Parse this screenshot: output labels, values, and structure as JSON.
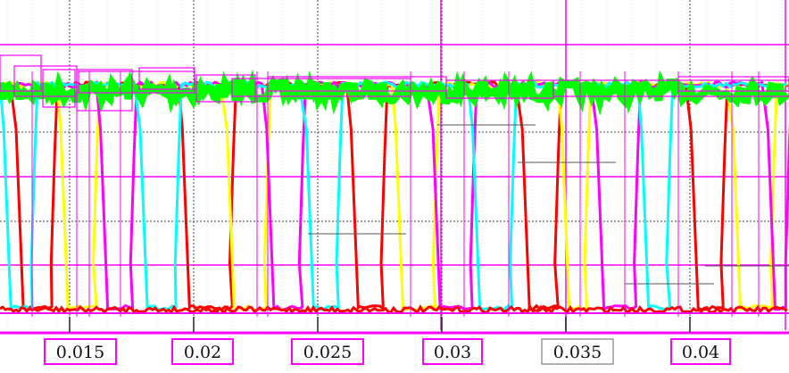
{
  "chart_data": {
    "type": "line",
    "title": "",
    "xlabel": "",
    "ylabel": "",
    "xlim": [
      0.0122,
      0.044
    ],
    "ylim": [
      0,
      1
    ],
    "grid": true,
    "x_ticks": [
      0.015,
      0.02,
      0.025,
      0.03,
      0.035,
      0.04
    ],
    "x_tick_labels": [
      "0.015",
      "0.02",
      "0.025",
      "0.03",
      "0.035",
      "0.04"
    ],
    "y_levels": {
      "high": 1,
      "low": 0
    },
    "series": [
      {
        "name": "red",
        "color": "#ff0000",
        "low_intervals": [
          [
            0.0127,
            0.0144
          ],
          [
            0.0194,
            0.0216
          ],
          [
            0.0262,
            0.0277
          ],
          [
            0.0331,
            0.0347
          ],
          [
            0.0399,
            0.0414
          ]
        ]
      },
      {
        "name": "yellow",
        "color": "#ffff00",
        "low_intervals": [
          [
            0.0145,
            0.0161
          ],
          [
            0.0212,
            0.023
          ],
          [
            0.028,
            0.0298
          ],
          [
            0.0347,
            0.0359
          ],
          [
            0.0416,
            0.0434
          ]
        ]
      },
      {
        "name": "magenta",
        "color": "#ff00ff",
        "low_intervals": [
          [
            0.0161,
            0.0176
          ],
          [
            0.0228,
            0.0244
          ],
          [
            0.0295,
            0.0313
          ],
          [
            0.0361,
            0.0379
          ],
          [
            0.043,
            0.044
          ]
        ]
      },
      {
        "name": "cyan",
        "color": "#00ffff",
        "low_intervals": [
          [
            0.0122,
            0.0136
          ],
          [
            0.0177,
            0.0194
          ],
          [
            0.0244,
            0.0259
          ],
          [
            0.0311,
            0.0329
          ],
          [
            0.0379,
            0.0392
          ]
        ]
      },
      {
        "name": "green",
        "color": "#00ff00",
        "mean_level": 0.97,
        "noise_band": 0.08
      }
    ]
  },
  "colors": {
    "accent": "#ff00ff",
    "grid": "#333333"
  }
}
